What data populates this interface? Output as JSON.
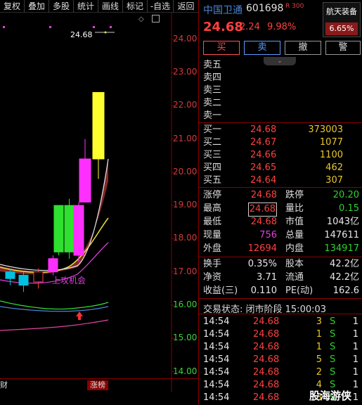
{
  "toolbar": [
    "复权",
    "叠加",
    "多股",
    "统计",
    "画线",
    "标记",
    "-自选",
    "返回"
  ],
  "chart": {
    "price_labels": [
      "24.00",
      "23.00",
      "22.00",
      "21.00",
      "20.00",
      "19.00",
      "18.00",
      "17.00",
      "16.00",
      "15.00",
      "14.00"
    ],
    "top_marker": "24.68",
    "annotation": "上攻机会",
    "bottom_left_tag": "财",
    "bottom_tag": "涨榜"
  },
  "chart_data": {
    "type": "candlestick",
    "ylim": [
      13.8,
      24.8
    ],
    "candles": [
      {
        "open": 17.0,
        "close": 16.8,
        "high": 17.1,
        "low": 16.6
      },
      {
        "open": 16.9,
        "close": 16.6,
        "high": 17.0,
        "low": 16.4
      },
      {
        "open": 17.0,
        "close": 16.7,
        "high": 17.1,
        "low": 16.5
      },
      {
        "open": 17.0,
        "close": 17.4,
        "high": 17.5,
        "low": 16.9
      },
      {
        "open": 17.6,
        "close": 19.0,
        "high": 19.0,
        "low": 17.5
      },
      {
        "open": 17.6,
        "close": 19.0,
        "high": 19.2,
        "low": 17.4
      },
      {
        "open": 17.5,
        "close": 19.0,
        "high": 19.1,
        "low": 17.3
      },
      {
        "open": 19.1,
        "close": 20.4,
        "high": 21.0,
        "low": 19.1
      },
      {
        "open": 20.4,
        "close": 22.4,
        "high": 22.4,
        "low": 19.8
      }
    ]
  },
  "stock": {
    "name": "中国卫通",
    "code": "601698",
    "r_tag": "R 300",
    "price": "24.68",
    "change": "2.24",
    "change_pct": "9.98%",
    "sector_name": "航天装备",
    "sector_pct": "6.65%"
  },
  "actions": {
    "buy": "买",
    "sell": "卖",
    "cancel": "撤",
    "alert": "警"
  },
  "asks": [
    {
      "label": "卖五",
      "price": "",
      "vol": ""
    },
    {
      "label": "卖四",
      "price": "",
      "vol": ""
    },
    {
      "label": "卖三",
      "price": "",
      "vol": ""
    },
    {
      "label": "卖二",
      "price": "",
      "vol": ""
    },
    {
      "label": "卖一",
      "price": "",
      "vol": ""
    }
  ],
  "bids": [
    {
      "label": "买一",
      "price": "24.68",
      "vol": "373003"
    },
    {
      "label": "买二",
      "price": "24.67",
      "vol": "1077"
    },
    {
      "label": "买三",
      "price": "24.66",
      "vol": "1100"
    },
    {
      "label": "买四",
      "price": "24.65",
      "vol": "462"
    },
    {
      "label": "买五",
      "price": "24.64",
      "vol": "307"
    }
  ],
  "stats": [
    {
      "l1": "涨停",
      "v1": "24.68",
      "l2": "跌停",
      "v2": "20.20"
    },
    {
      "l1": "最高",
      "v1": "24.68",
      "l2": "量比",
      "v2": "0.15"
    },
    {
      "l1": "最低",
      "v1": "24.68",
      "l2": "市值",
      "v2": "1043亿"
    },
    {
      "l1": "现量",
      "v1": "756",
      "l2": "总量",
      "v2": "147611"
    },
    {
      "l1": "外盘",
      "v1": "12694",
      "l2": "内盘",
      "v2": "134917"
    }
  ],
  "stats2": [
    {
      "l1": "换手",
      "v1": "0.35%",
      "l2": "股本",
      "v2": "42.2亿"
    },
    {
      "l1": "净资",
      "v1": "3.71",
      "l2": "流通",
      "v2": "42.2亿"
    },
    {
      "l1": "收益(三)",
      "v1": "0.110",
      "l2": "PE(动)",
      "v2": "162.6"
    }
  ],
  "trade_status": "交易状态: 闭市阶段 15:00:03",
  "ticks": [
    {
      "time": "14:54",
      "price": "24.68",
      "vol": "3",
      "side": "S",
      "num": "1"
    },
    {
      "time": "14:54",
      "price": "24.68",
      "vol": "1",
      "side": "S",
      "num": "1"
    },
    {
      "time": "14:54",
      "price": "24.68",
      "vol": "1",
      "side": "S",
      "num": "1"
    },
    {
      "time": "14:54",
      "price": "24.68",
      "vol": "5",
      "side": "S",
      "num": "1"
    },
    {
      "time": "14:54",
      "price": "24.68",
      "vol": "2",
      "side": "S",
      "num": "1"
    },
    {
      "time": "14:54",
      "price": "24.68",
      "vol": "4",
      "side": "S",
      "num": "1"
    },
    {
      "time": "14:54",
      "price": "24.68",
      "vol": "3",
      "side": "S",
      "num": "1"
    }
  ],
  "watermark": "股海游侠"
}
